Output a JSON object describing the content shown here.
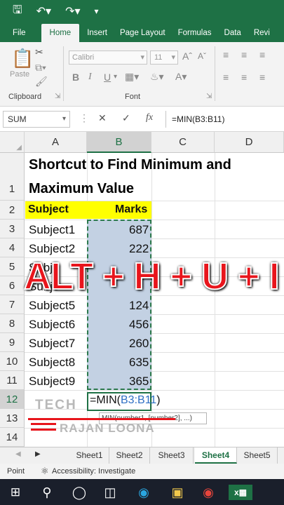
{
  "qat": {
    "save_icon": "save-icon",
    "undo_icon": "undo-icon",
    "redo_icon": "redo-icon",
    "more_icon": "customize-icon"
  },
  "tabs": [
    "File",
    "Home",
    "Insert",
    "Page Layout",
    "Formulas",
    "Data",
    "Revi"
  ],
  "ribbon": {
    "paste_label": "Paste",
    "clipboard_label": "Clipboard",
    "font_label": "Font",
    "font_name": "Calibri",
    "font_size": "11",
    "bold": "B",
    "italic": "I",
    "underline": "U"
  },
  "formula_bar": {
    "name_box": "SUM",
    "cancel": "✕",
    "enter": "✓",
    "fx": "fx",
    "formula": "=MIN(B3:B11)"
  },
  "columns": [
    "A",
    "B",
    "C",
    "D"
  ],
  "rows": [
    "1",
    "2",
    "3",
    "4",
    "5",
    "6",
    "7",
    "8",
    "9",
    "10",
    "11",
    "12",
    "13",
    "14"
  ],
  "sheet": {
    "title_line1": "Shortcut to Find Minimum and",
    "title_line2": "Maximum Value",
    "header_subject": "Subject",
    "header_marks": "Marks",
    "data": [
      {
        "subject": "Subject1",
        "marks": "687"
      },
      {
        "subject": "Subject2",
        "marks": "222"
      },
      {
        "subject": "Subje",
        "marks": ""
      },
      {
        "subject": "Subje",
        "marks": ""
      },
      {
        "subject": "Subject5",
        "marks": "124"
      },
      {
        "subject": "Subject6",
        "marks": "456"
      },
      {
        "subject": "Subject7",
        "marks": "260"
      },
      {
        "subject": "Subject8",
        "marks": "635"
      },
      {
        "subject": "Subject9",
        "marks": "365"
      }
    ],
    "editing_prefix": "=MIN(",
    "editing_ref": "B3:B11",
    "editing_suffix": ")",
    "tooltip": "MIN(number1, [number2], ...)"
  },
  "overlay": {
    "shortcut": "ALT + H + U + I",
    "watermark_top": "TECH",
    "watermark_bottom": "RAJAN LOONA"
  },
  "sheet_tabs": [
    "Sheet1",
    "Sheet2",
    "Sheet3",
    "Sheet4",
    "Sheet5"
  ],
  "status": {
    "mode": "Point",
    "accessibility": "Accessibility: Investigate"
  },
  "taskbar_icons": [
    "windows-start-icon",
    "search-icon",
    "cortana-icon",
    "task-view-icon",
    "edge-icon",
    "file-explorer-icon",
    "chrome-icon",
    "excel-icon"
  ],
  "colors": {
    "excel_green": "#1e7145",
    "highlight_yellow": "#ffff00",
    "range_fill": "#c3d1e3",
    "overlay_red": "#e8151c"
  }
}
